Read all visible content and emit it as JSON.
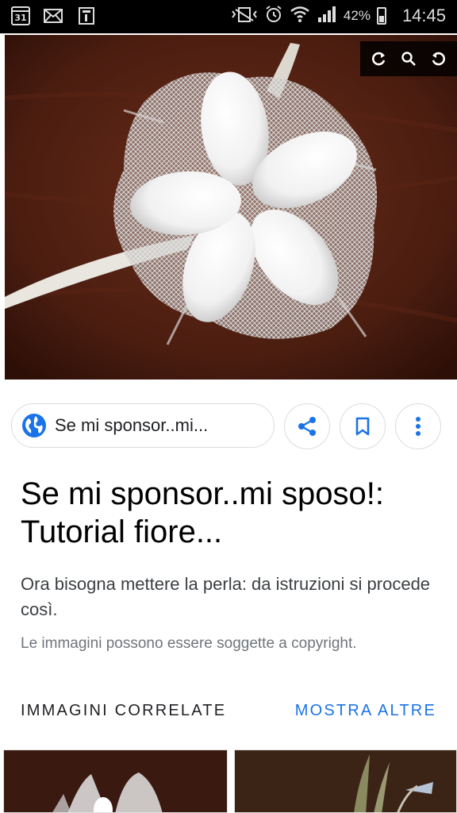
{
  "status_bar": {
    "calendar_day": "31",
    "battery_percent": "42%",
    "time": "14:45",
    "icons": [
      "calendar-icon",
      "mail-icon",
      "clipboard-icon",
      "vibrate-mute-icon",
      "alarm-icon",
      "wifi-icon",
      "signal-icon",
      "battery-icon"
    ]
  },
  "image_toolbar": {
    "icons": [
      "lens-refresh-icon",
      "search-icon",
      "rotate-icon"
    ]
  },
  "actions": {
    "source_label": "Se mi sponsor..mi...",
    "icons": [
      "globe-icon",
      "share-icon",
      "bookmark-icon",
      "more-vert-icon"
    ]
  },
  "result": {
    "title": "Se mi sponsor..mi sposo!: Tutorial fiore...",
    "description": "Ora bisogna mettere la perla: da istruzioni si procede così.",
    "copyright_notice": "Le immagini possono essere soggette a copyright."
  },
  "related": {
    "heading": "IMMAGINI CORRELATE",
    "more_label": "MOSTRA ALTRE"
  },
  "colors": {
    "accent": "#1a73e8",
    "status_bar": "#000000",
    "image_background": "#4a1f12"
  }
}
